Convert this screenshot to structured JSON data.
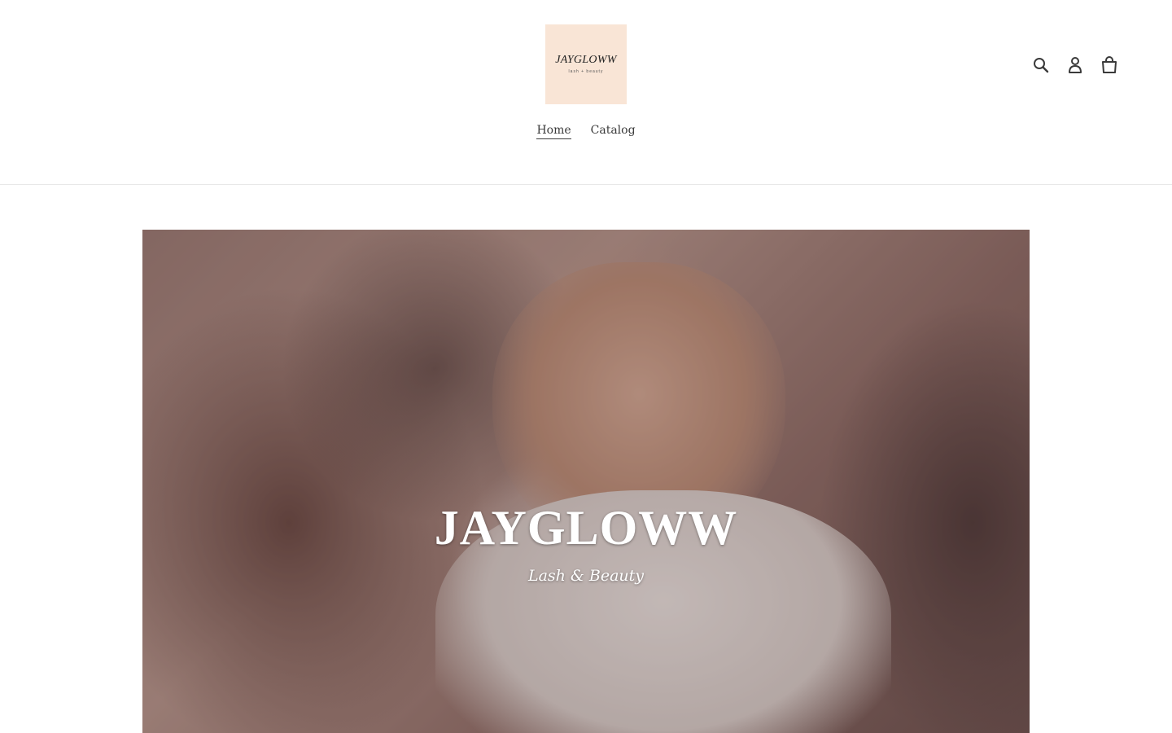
{
  "brand": {
    "logo_title": "JAYGLOWW",
    "logo_subtitle": "lash + beauty",
    "logo_bg_color": "#f9e5d6"
  },
  "header": {
    "icons": [
      "search-icon",
      "account-icon",
      "cart-icon"
    ]
  },
  "nav": {
    "items": [
      {
        "label": "Home",
        "active": true
      },
      {
        "label": "Catalog",
        "active": false
      }
    ]
  },
  "hero": {
    "title": "JAYGLOWW",
    "subtitle": "Lash & Beauty"
  }
}
